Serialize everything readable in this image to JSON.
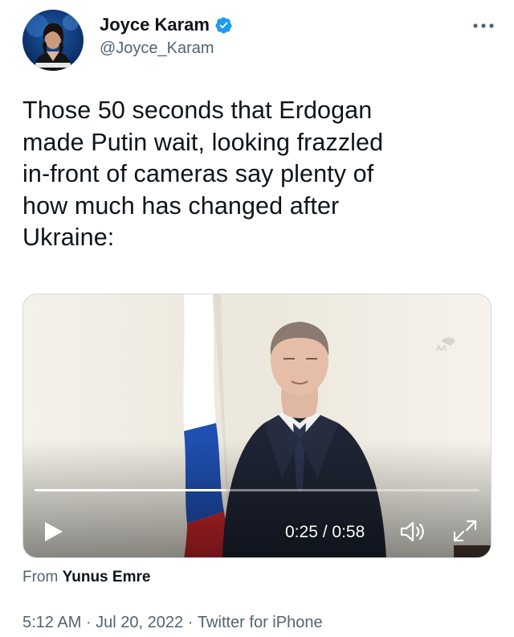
{
  "author": {
    "display_name": "Joyce Karam",
    "handle": "@Joyce_Karam",
    "verified": true,
    "avatar_caption": "سكاي نيوز عربية"
  },
  "tweet": {
    "text": "Those 50 seconds that Erdogan\nmade Putin wait, looking frazzled\nin-front of cameras say plenty of\nhow much has changed after\nUkraine:"
  },
  "video": {
    "current_time": "0:25",
    "separator": " / ",
    "duration": "0:58",
    "progress": 0.43,
    "watermark": "AA"
  },
  "attribution": {
    "prefix": "From ",
    "source": "Yunus Emre"
  },
  "meta": {
    "time": "5:12 AM",
    "dot1": " · ",
    "date": "Jul 20, 2022",
    "dot2": " · ",
    "client": "Twitter for iPhone"
  },
  "icons": {
    "verified": "verified-badge-icon",
    "more": "more-dots-icon",
    "play": "play-icon",
    "volume": "volume-icon",
    "fullscreen": "fullscreen-icon"
  },
  "colors": {
    "verified_blue": "#1d9bf0",
    "secondary_text": "#536471",
    "primary_text": "#0f1419"
  }
}
